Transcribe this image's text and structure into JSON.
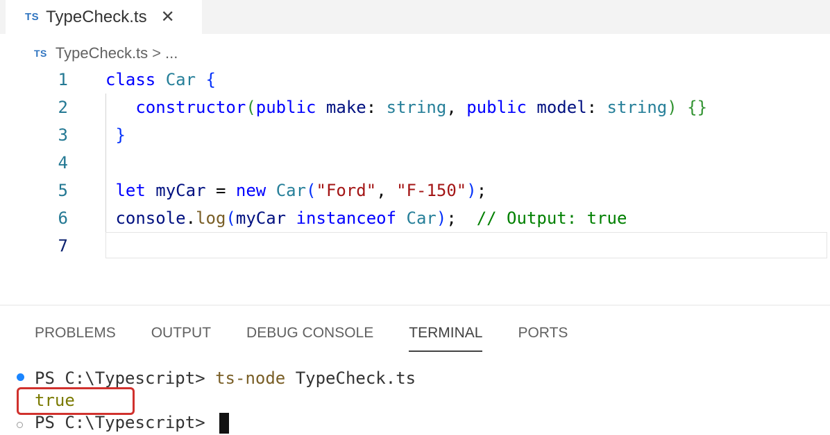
{
  "tab": {
    "icon": "TS",
    "title": "TypeCheck.ts",
    "close": "✕"
  },
  "breadcrumb": {
    "icon": "TS",
    "file": "TypeCheck.ts",
    "separator": ">",
    "more": "..."
  },
  "editor": {
    "line_numbers": [
      "1",
      "2",
      "3",
      "4",
      "5",
      "6",
      "7"
    ],
    "lines": [
      [
        {
          "t": "class",
          "c": "kw"
        },
        {
          "t": " ",
          "c": "plain"
        },
        {
          "t": "Car",
          "c": "cls"
        },
        {
          "t": " ",
          "c": "plain"
        },
        {
          "t": "{",
          "c": "br1"
        }
      ],
      [
        {
          "t": "   ",
          "c": "plain"
        },
        {
          "t": "constructor",
          "c": "kw"
        },
        {
          "t": "(",
          "c": "br2"
        },
        {
          "t": "public",
          "c": "kw"
        },
        {
          "t": " ",
          "c": "plain"
        },
        {
          "t": "make",
          "c": "var"
        },
        {
          "t": ": ",
          "c": "plain"
        },
        {
          "t": "string",
          "c": "cls"
        },
        {
          "t": ", ",
          "c": "plain"
        },
        {
          "t": "public",
          "c": "kw"
        },
        {
          "t": " ",
          "c": "plain"
        },
        {
          "t": "model",
          "c": "var"
        },
        {
          "t": ": ",
          "c": "plain"
        },
        {
          "t": "string",
          "c": "cls"
        },
        {
          "t": ")",
          "c": "br2"
        },
        {
          "t": " ",
          "c": "plain"
        },
        {
          "t": "{}",
          "c": "br2"
        }
      ],
      [
        {
          "t": " ",
          "c": "plain"
        },
        {
          "t": "}",
          "c": "br1"
        }
      ],
      [],
      [
        {
          "t": " ",
          "c": "plain"
        },
        {
          "t": "let",
          "c": "kw"
        },
        {
          "t": " ",
          "c": "plain"
        },
        {
          "t": "myCar",
          "c": "var"
        },
        {
          "t": " = ",
          "c": "plain"
        },
        {
          "t": "new",
          "c": "kw"
        },
        {
          "t": " ",
          "c": "plain"
        },
        {
          "t": "Car",
          "c": "cls"
        },
        {
          "t": "(",
          "c": "br1"
        },
        {
          "t": "\"Ford\"",
          "c": "str"
        },
        {
          "t": ", ",
          "c": "plain"
        },
        {
          "t": "\"F-150\"",
          "c": "str"
        },
        {
          "t": ")",
          "c": "br1"
        },
        {
          "t": ";",
          "c": "plain"
        }
      ],
      [
        {
          "t": " ",
          "c": "plain"
        },
        {
          "t": "console",
          "c": "var"
        },
        {
          "t": ".",
          "c": "plain"
        },
        {
          "t": "log",
          "c": "fn"
        },
        {
          "t": "(",
          "c": "br1"
        },
        {
          "t": "myCar",
          "c": "var"
        },
        {
          "t": " ",
          "c": "plain"
        },
        {
          "t": "instanceof",
          "c": "kw"
        },
        {
          "t": " ",
          "c": "plain"
        },
        {
          "t": "Car",
          "c": "cls"
        },
        {
          "t": ")",
          "c": "br1"
        },
        {
          "t": ";  ",
          "c": "plain"
        },
        {
          "t": "// Output: true",
          "c": "cmt"
        }
      ],
      []
    ]
  },
  "panel": {
    "tabs": [
      "PROBLEMS",
      "OUTPUT",
      "DEBUG CONSOLE",
      "TERMINAL",
      "PORTS"
    ],
    "active_tab": "TERMINAL"
  },
  "terminal": {
    "prompt1": "PS C:\\Typescript> ",
    "command": "ts-node",
    "command_arg": " TypeCheck.ts",
    "output": "true",
    "prompt2": "PS C:\\Typescript> "
  },
  "colors": {
    "ts_icon": "#2f74c0",
    "highlight_box": "#d0312d",
    "terminal_dot": "#1a85ff"
  }
}
